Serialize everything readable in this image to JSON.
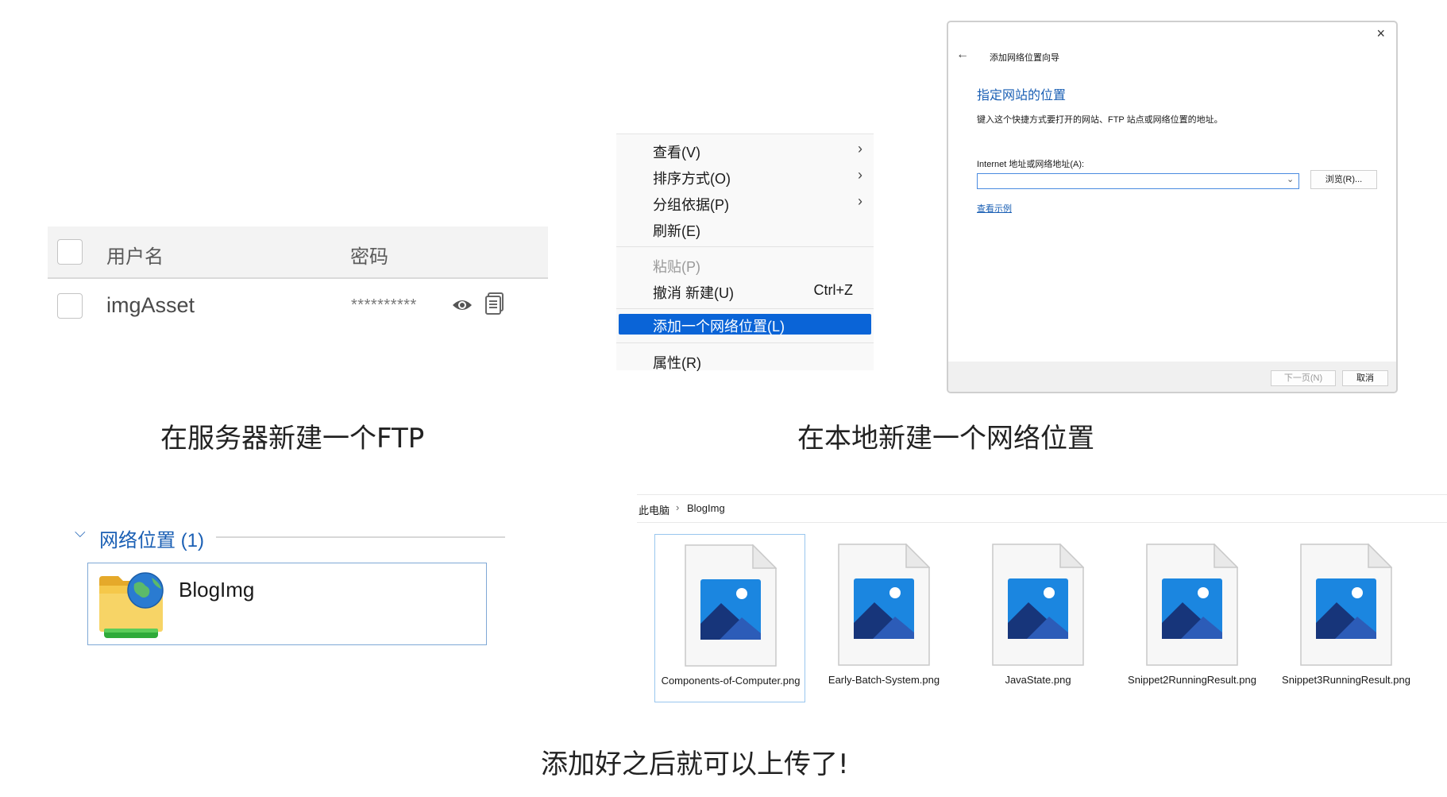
{
  "ftp_table": {
    "col_user": "用户名",
    "col_password": "密码",
    "row": {
      "username": "imgAsset",
      "password": "**********"
    }
  },
  "context_menu": {
    "items": [
      {
        "label": "查看(V)"
      },
      {
        "label": "排序方式(O)"
      },
      {
        "label": "分组依据(P)"
      },
      {
        "label": "刷新(E)"
      },
      {
        "label": "粘贴(P)"
      },
      {
        "label": "撤消 新建(U)",
        "shortcut": "Ctrl+Z"
      },
      {
        "label": "添加一个网络位置(L)"
      },
      {
        "label": "属性(R)"
      }
    ],
    "highlight_color": "#0a64d7"
  },
  "wizard": {
    "window_title": "添加网络位置向导",
    "heading": "指定网站的位置",
    "description": "键入这个快捷方式要打开的网站、FTP 站点或网络位置的地址。",
    "address_label": "Internet 地址或网络地址(A):",
    "address_value": "",
    "browse_button": "浏览(R)...",
    "example_link": "查看示例",
    "next_button": "下一页(N)",
    "cancel_button": "取消",
    "heading_color": "#1a5fb4"
  },
  "captions": {
    "ftp": "在服务器新建一个FTP",
    "local": "在本地新建一个网络位置",
    "done": "添加好之后就可以上传了!"
  },
  "network_location": {
    "group_title": "网络位置 (1)",
    "item_name": "BlogImg"
  },
  "explorer": {
    "breadcrumb": [
      "此电脑",
      "BlogImg"
    ],
    "files": [
      "Components-of-Computer.png",
      "Early-Batch-System.png",
      "JavaState.png",
      "Snippet2RunningResult.png",
      "Snippet3RunningResult.png"
    ]
  }
}
